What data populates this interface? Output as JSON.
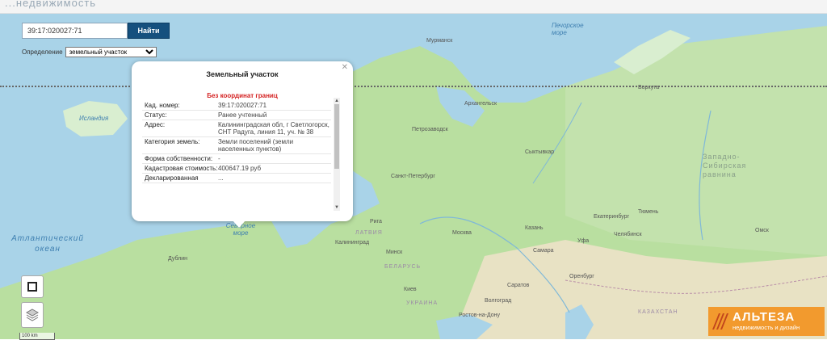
{
  "header": {
    "title": "...недвижимость"
  },
  "search": {
    "value": "39:17:020027:71",
    "button_label": "Найти"
  },
  "definition": {
    "label": "Определение",
    "selected": "земельный участок"
  },
  "popup": {
    "title": "Земельный участок",
    "warning": "Без координат границ",
    "rows": [
      {
        "key": "Кад. номер:",
        "value": "39:17:020027:71"
      },
      {
        "key": "Статус:",
        "value": "Ранее учтенный"
      },
      {
        "key": "Адрес:",
        "value": "Калининградская обл, г Светлогорск, СНТ Радуга, линия 11, уч. № 38"
      },
      {
        "key": "Категория земель:",
        "value": "Земли поселений (земли населенных пунктов)"
      },
      {
        "key": "Форма собственности:",
        "value": "-"
      },
      {
        "key": "Кадастровая стоимость:",
        "value": "400647.19 руб"
      },
      {
        "key": "Декларированная",
        "value": "..."
      }
    ]
  },
  "map_labels": {
    "pechorskoe_more": "Печорское море",
    "murmansk": "Мурманск",
    "islandia": "Исландия",
    "arkhangelsk": "Архангельск",
    "petrozavodsk": "Петрозаводск",
    "vorkuta": "Воркута",
    "syktyvkar": "Сыктывкар",
    "zapadno_sibirskaya": "Западно-Сибирская равнина",
    "saint_petersburg": "Санкт-Петербург",
    "ekaterinburg": "Екатеринбург",
    "tyumen": "Тюмень",
    "kazan": "Казань",
    "chelyabinsk": "Челябинск",
    "samara": "Самара",
    "ufa": "Уфа",
    "omsk": "Омск",
    "moscow": "Москва",
    "severnoe_more": "Северное море",
    "atlantic": "Атлантический океан",
    "latvia": "ЛАТВИЯ",
    "belarus": "БЕЛАРУСЬ",
    "ukraine": "УКРАИНА",
    "kazakhstan": "КАЗАХСТАН",
    "kaliningrad": "Калининград",
    "dublin": "Дублин",
    "rostov": "Ростов-на-Дону",
    "saratov": "Саратов",
    "orenburg": "Оренбург",
    "volgograd": "Волгоград",
    "minsk": "Минск",
    "riga": "Рига",
    "kiev": "Киев"
  },
  "scale": {
    "label": "100 km"
  },
  "logo": {
    "name": "АЛЬТЕЗА",
    "subtitle": "недвижимость и дизайн"
  },
  "colors": {
    "water": "#a9d3e8",
    "land": "#b9dfa0",
    "accent": "#15507e",
    "warning": "#d42121",
    "logo": "#f29a2e"
  }
}
